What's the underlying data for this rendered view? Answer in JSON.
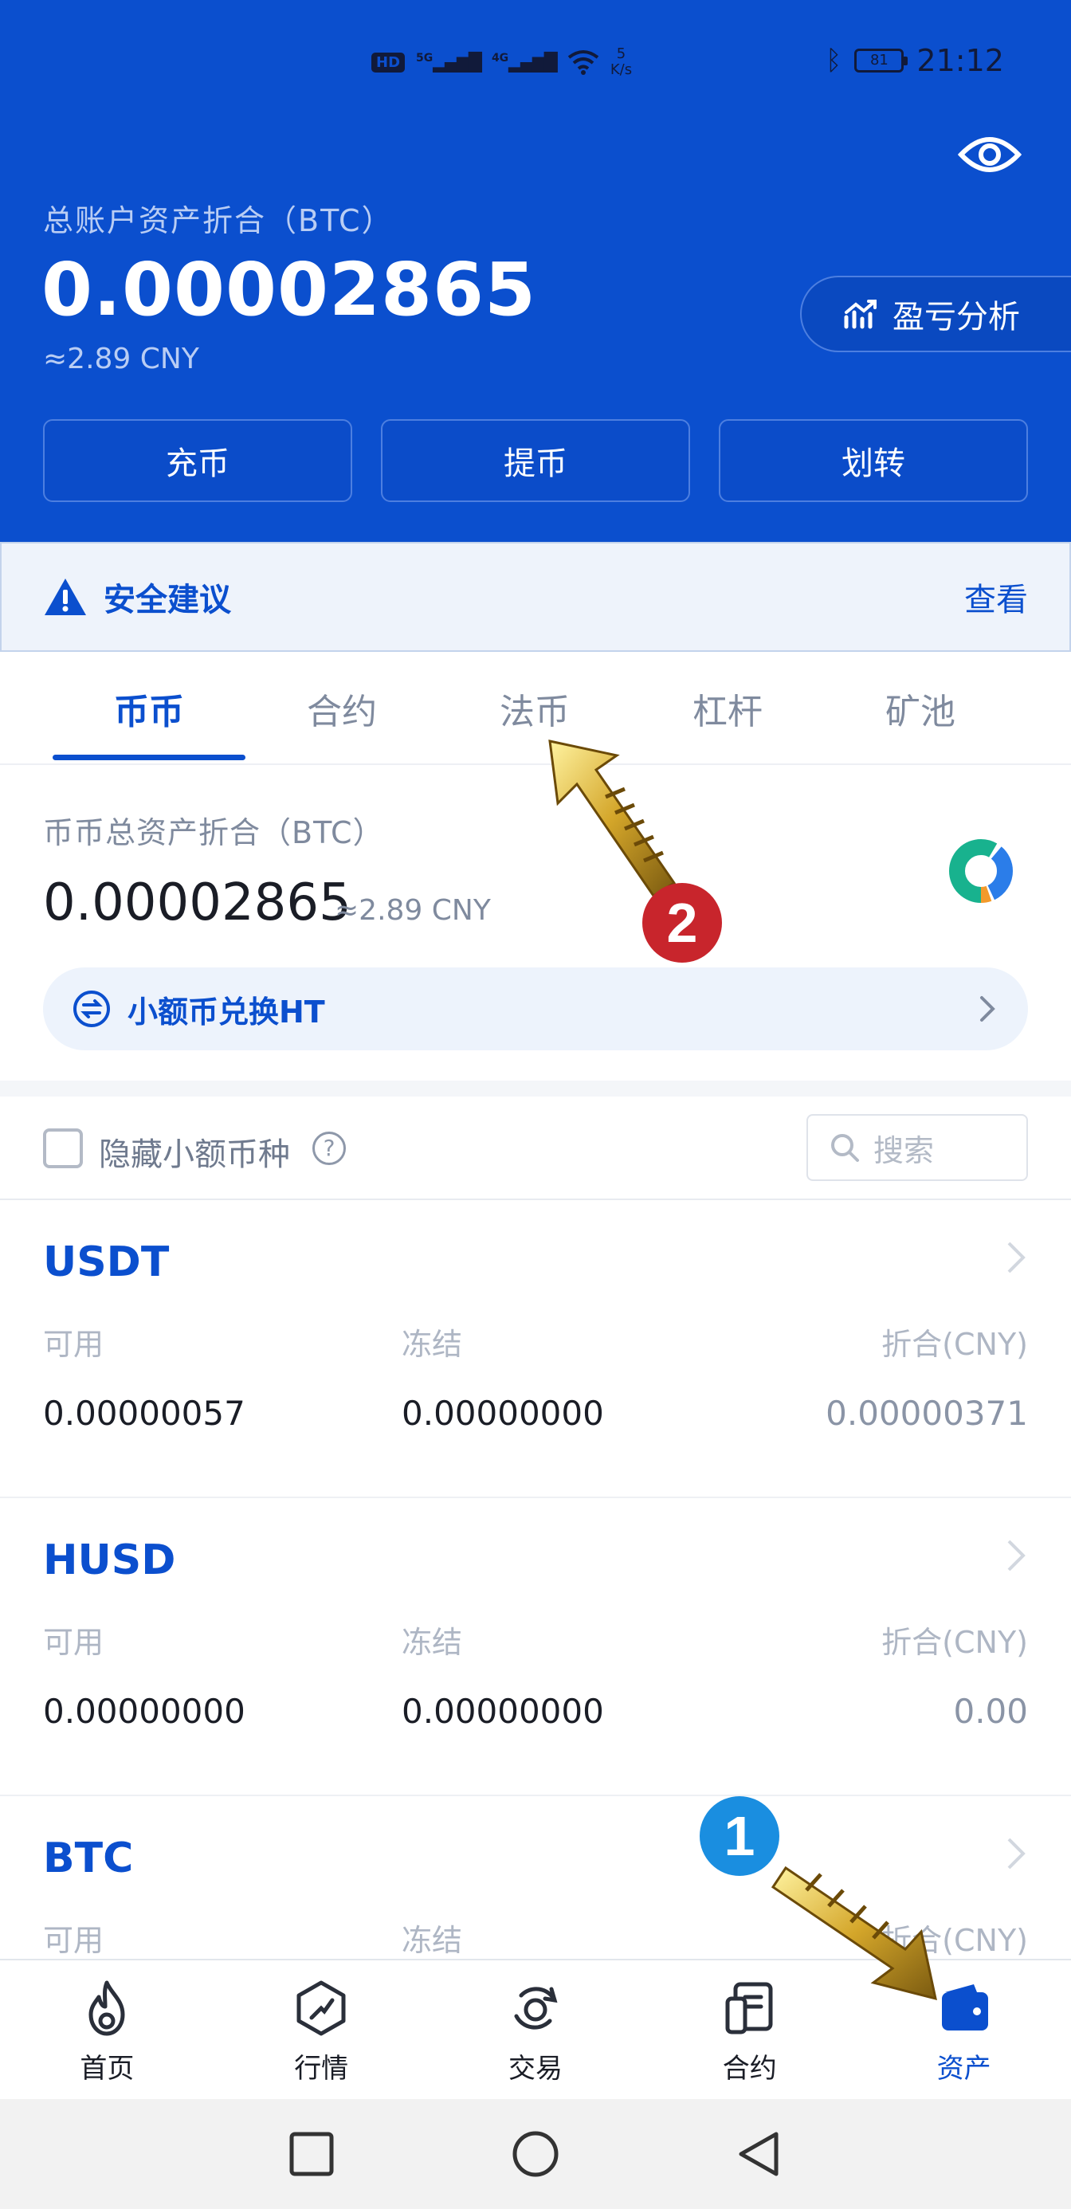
{
  "status_bar": {
    "hd": "HD",
    "net_5g": "5G",
    "net_4g": "4G",
    "speed_value": "5",
    "speed_unit": "K/s",
    "battery": "81",
    "time": "21:12"
  },
  "account": {
    "total_label": "总账户资产折合（BTC）",
    "total_value": "0.00002865",
    "total_cny": "≈2.89 CNY",
    "pl_button": "盈亏分析",
    "actions": [
      "充币",
      "提币",
      "划转"
    ]
  },
  "security": {
    "text": "安全建议",
    "link": "查看"
  },
  "tabs": [
    {
      "label": "币币",
      "active": true
    },
    {
      "label": "合约",
      "active": false
    },
    {
      "label": "法币",
      "active": false
    },
    {
      "label": "杠杆",
      "active": false
    },
    {
      "label": "矿池",
      "active": false
    }
  ],
  "summary": {
    "label": "币币总资产折合（BTC）",
    "value": "0.00002865",
    "cny": "≈2.89 CNY",
    "small_convert": "小额币兑换HT"
  },
  "filter": {
    "hide_label": "隐藏小额币种",
    "help": "?",
    "search_placeholder": "搜索"
  },
  "coins": [
    {
      "name": "USDT",
      "available_label": "可用",
      "available": "0.00000057",
      "frozen_label": "冻结",
      "frozen": "0.00000000",
      "cny_label": "折合(CNY)",
      "cny": "0.00000371"
    },
    {
      "name": "HUSD",
      "available_label": "可用",
      "available": "0.00000000",
      "frozen_label": "冻结",
      "frozen": "0.00000000",
      "cny_label": "折合(CNY)",
      "cny": "0.00"
    },
    {
      "name": "BTC",
      "available_label": "可用",
      "available": "",
      "frozen_label": "冻结",
      "frozen": "",
      "cny_label": "折合(CNY)",
      "cny": ""
    }
  ],
  "bottom_nav": [
    {
      "label": "首页",
      "icon": "fire-icon"
    },
    {
      "label": "行情",
      "icon": "market-icon"
    },
    {
      "label": "交易",
      "icon": "trade-icon"
    },
    {
      "label": "合约",
      "icon": "contract-icon"
    },
    {
      "label": "资产",
      "icon": "wallet-icon",
      "active": true
    }
  ],
  "annotations": {
    "marker_1": "1",
    "marker_2": "2"
  },
  "colors": {
    "brand_blue": "#0b4fce",
    "annotation_gold": "#c9a227",
    "marker_red": "#c8252c",
    "marker_blue": "#1a8ee0"
  }
}
